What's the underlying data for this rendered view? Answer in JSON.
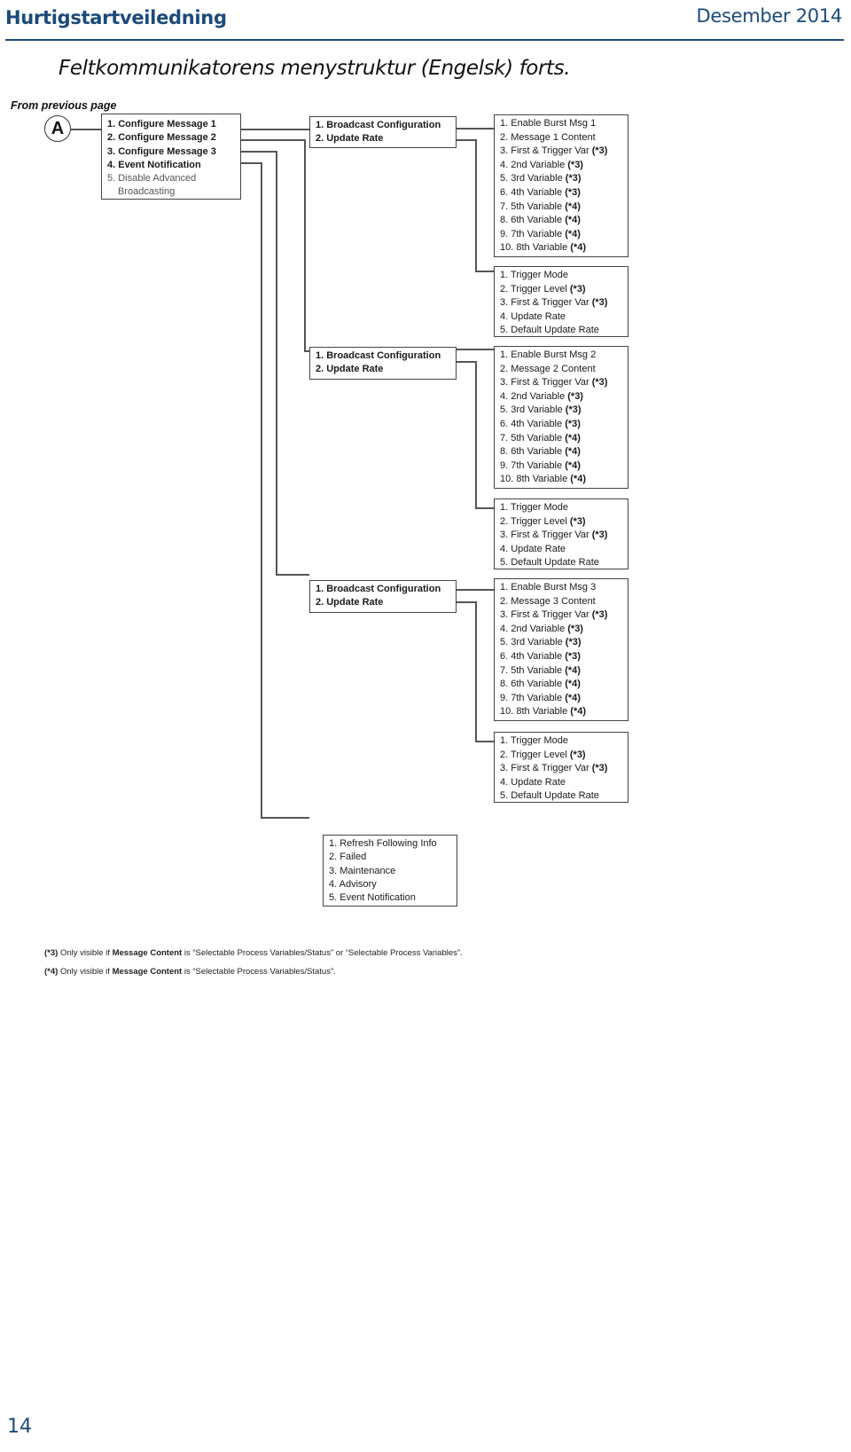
{
  "header": {
    "title": "Hurtigstartveiledning",
    "date": "Desember 2014",
    "accent_color": "#1b4a7a"
  },
  "heading": "Feltkommunikatorens menystruktur (Engelsk) forts.",
  "from_previous": "From previous page",
  "connector_label": "A",
  "root_menu": {
    "items": [
      "1. Configure Message 1",
      "2. Configure Message 2",
      "3. Configure Message 3",
      "4. Event Notification",
      "5. Disable Advanced",
      "Broadcasting"
    ]
  },
  "messages": [
    {
      "submenu": [
        "1. Broadcast Configuration",
        "2. Update Rate"
      ],
      "broadcast": [
        {
          "text": "1. Enable Burst Msg 1",
          "note": ""
        },
        {
          "text": "2. Message 1 Content",
          "note": ""
        },
        {
          "text": "3. First & Trigger Var ",
          "note": "(*3)"
        },
        {
          "text": "4. 2nd Variable ",
          "note": "(*3)"
        },
        {
          "text": "5. 3rd Variable ",
          "note": "(*3)"
        },
        {
          "text": "6. 4th Variable ",
          "note": "(*3)"
        },
        {
          "text": "7. 5th Variable ",
          "note": "(*4)"
        },
        {
          "text": "8. 6th Variable ",
          "note": "(*4)"
        },
        {
          "text": "9. 7th Variable ",
          "note": "(*4)"
        },
        {
          "text": "10. 8th Variable ",
          "note": "(*4)"
        }
      ],
      "update_rate": [
        {
          "text": "1. Trigger Mode",
          "note": ""
        },
        {
          "text": "2. Trigger Level ",
          "note": "(*3)"
        },
        {
          "text": "3. First & Trigger Var ",
          "note": "(*3)"
        },
        {
          "text": "4. Update Rate",
          "note": ""
        },
        {
          "text": "5. Default Update Rate",
          "note": ""
        }
      ]
    },
    {
      "submenu": [
        "1. Broadcast Configuration",
        "2. Update Rate"
      ],
      "broadcast": [
        {
          "text": "1. Enable Burst Msg 2",
          "note": ""
        },
        {
          "text": "2. Message 2 Content",
          "note": ""
        },
        {
          "text": "3. First & Trigger Var ",
          "note": "(*3)"
        },
        {
          "text": "4. 2nd Variable ",
          "note": "(*3)"
        },
        {
          "text": "5. 3rd Variable ",
          "note": "(*3)"
        },
        {
          "text": "6. 4th Variable ",
          "note": "(*3)"
        },
        {
          "text": "7. 5th Variable ",
          "note": "(*4)"
        },
        {
          "text": "8. 6th Variable ",
          "note": "(*4)"
        },
        {
          "text": "9. 7th Variable ",
          "note": "(*4)"
        },
        {
          "text": "10. 8th Variable ",
          "note": "(*4)"
        }
      ],
      "update_rate": [
        {
          "text": "1. Trigger Mode",
          "note": ""
        },
        {
          "text": "2. Trigger Level ",
          "note": "(*3)"
        },
        {
          "text": "3. First & Trigger Var ",
          "note": "(*3)"
        },
        {
          "text": "4. Update Rate",
          "note": ""
        },
        {
          "text": "5. Default Update Rate",
          "note": ""
        }
      ]
    },
    {
      "submenu": [
        "1. Broadcast Configuration",
        "2. Update Rate"
      ],
      "broadcast": [
        {
          "text": "1. Enable Burst Msg 3",
          "note": ""
        },
        {
          "text": "2. Message 3 Content",
          "note": ""
        },
        {
          "text": "3. First & Trigger Var ",
          "note": "(*3)"
        },
        {
          "text": "4. 2nd Variable ",
          "note": "(*3)"
        },
        {
          "text": "5. 3rd Variable ",
          "note": "(*3)"
        },
        {
          "text": "6. 4th Variable ",
          "note": "(*3)"
        },
        {
          "text": "7. 5th Variable ",
          "note": "(*4)"
        },
        {
          "text": "8. 6th Variable ",
          "note": "(*4)"
        },
        {
          "text": "9. 7th Variable ",
          "note": "(*4)"
        },
        {
          "text": "10. 8th Variable ",
          "note": "(*4)"
        }
      ],
      "update_rate": [
        {
          "text": "1. Trigger Mode",
          "note": ""
        },
        {
          "text": "2. Trigger Level ",
          "note": "(*3)"
        },
        {
          "text": "3. First & Trigger Var ",
          "note": "(*3)"
        },
        {
          "text": "4. Update Rate",
          "note": ""
        },
        {
          "text": "5. Default Update Rate",
          "note": ""
        }
      ]
    }
  ],
  "event_notification": [
    "1. Refresh Following Info",
    "2. Failed",
    "3. Maintenance",
    "4. Advisory",
    "5. Event Notification"
  ],
  "footnotes": [
    {
      "mark": "(*3)",
      "pre": " Only visible if ",
      "bold": "Message Content",
      "post": " is “Selectable Process Variables/Status” or “Selectable Process Variables”."
    },
    {
      "mark": "(*4)",
      "pre": " Only visible if ",
      "bold": "Message Content",
      "post": " is “Selectable Process Variables/Status”."
    }
  ],
  "page_number": "14"
}
